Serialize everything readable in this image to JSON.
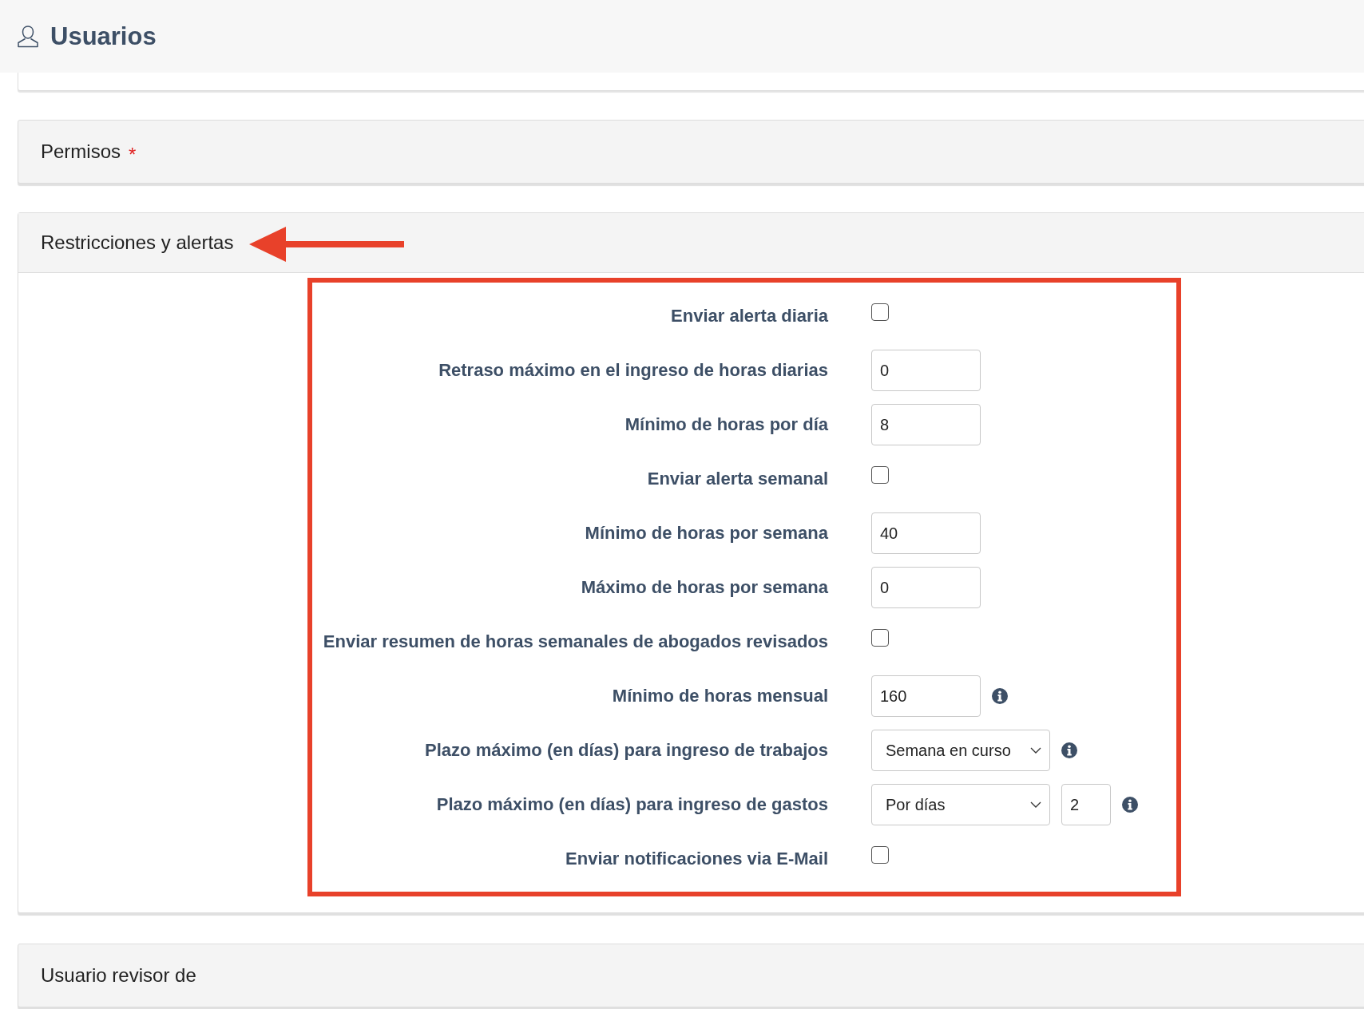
{
  "page": {
    "title": "Usuarios"
  },
  "panels": [
    {
      "title": "Permisos",
      "required": true,
      "required_mark": "*"
    }
  ],
  "restrictions": {
    "title": "Restricciones y alertas",
    "fields": [
      {
        "kind": "checkbox",
        "label": "Enviar alerta diaria",
        "checked": false,
        "info": false
      },
      {
        "kind": "input",
        "label": "Retraso máximo en el ingreso de horas diarias",
        "value": "0",
        "info": false
      },
      {
        "kind": "input",
        "label": "Mínimo de horas por día",
        "value": "8",
        "info": false
      },
      {
        "kind": "checkbox",
        "label": "Enviar alerta semanal",
        "checked": false,
        "info": false
      },
      {
        "kind": "input",
        "label": "Mínimo de horas por semana",
        "value": "40",
        "info": false
      },
      {
        "kind": "input",
        "label": "Máximo de horas por semana",
        "value": "0",
        "info": false
      },
      {
        "kind": "checkbox",
        "label": "Enviar resumen de horas semanales de abogados revisados",
        "checked": false,
        "info": false
      },
      {
        "kind": "input",
        "label": "Mínimo de horas mensual",
        "value": "160",
        "info": true
      },
      {
        "kind": "select",
        "label": "Plazo máximo (en días) para ingreso de trabajos",
        "value": "Semana en curso",
        "info": true
      },
      {
        "kind": "select_input",
        "label": "Plazo máximo (en días) para ingreso de gastos",
        "value": "Por días",
        "extra_value": "2",
        "info": true
      },
      {
        "kind": "checkbox",
        "label": "Enviar notificaciones via E-Mail",
        "checked": false,
        "info": false
      }
    ]
  },
  "bottom_panel": {
    "title": "Usuario revisor de"
  }
}
